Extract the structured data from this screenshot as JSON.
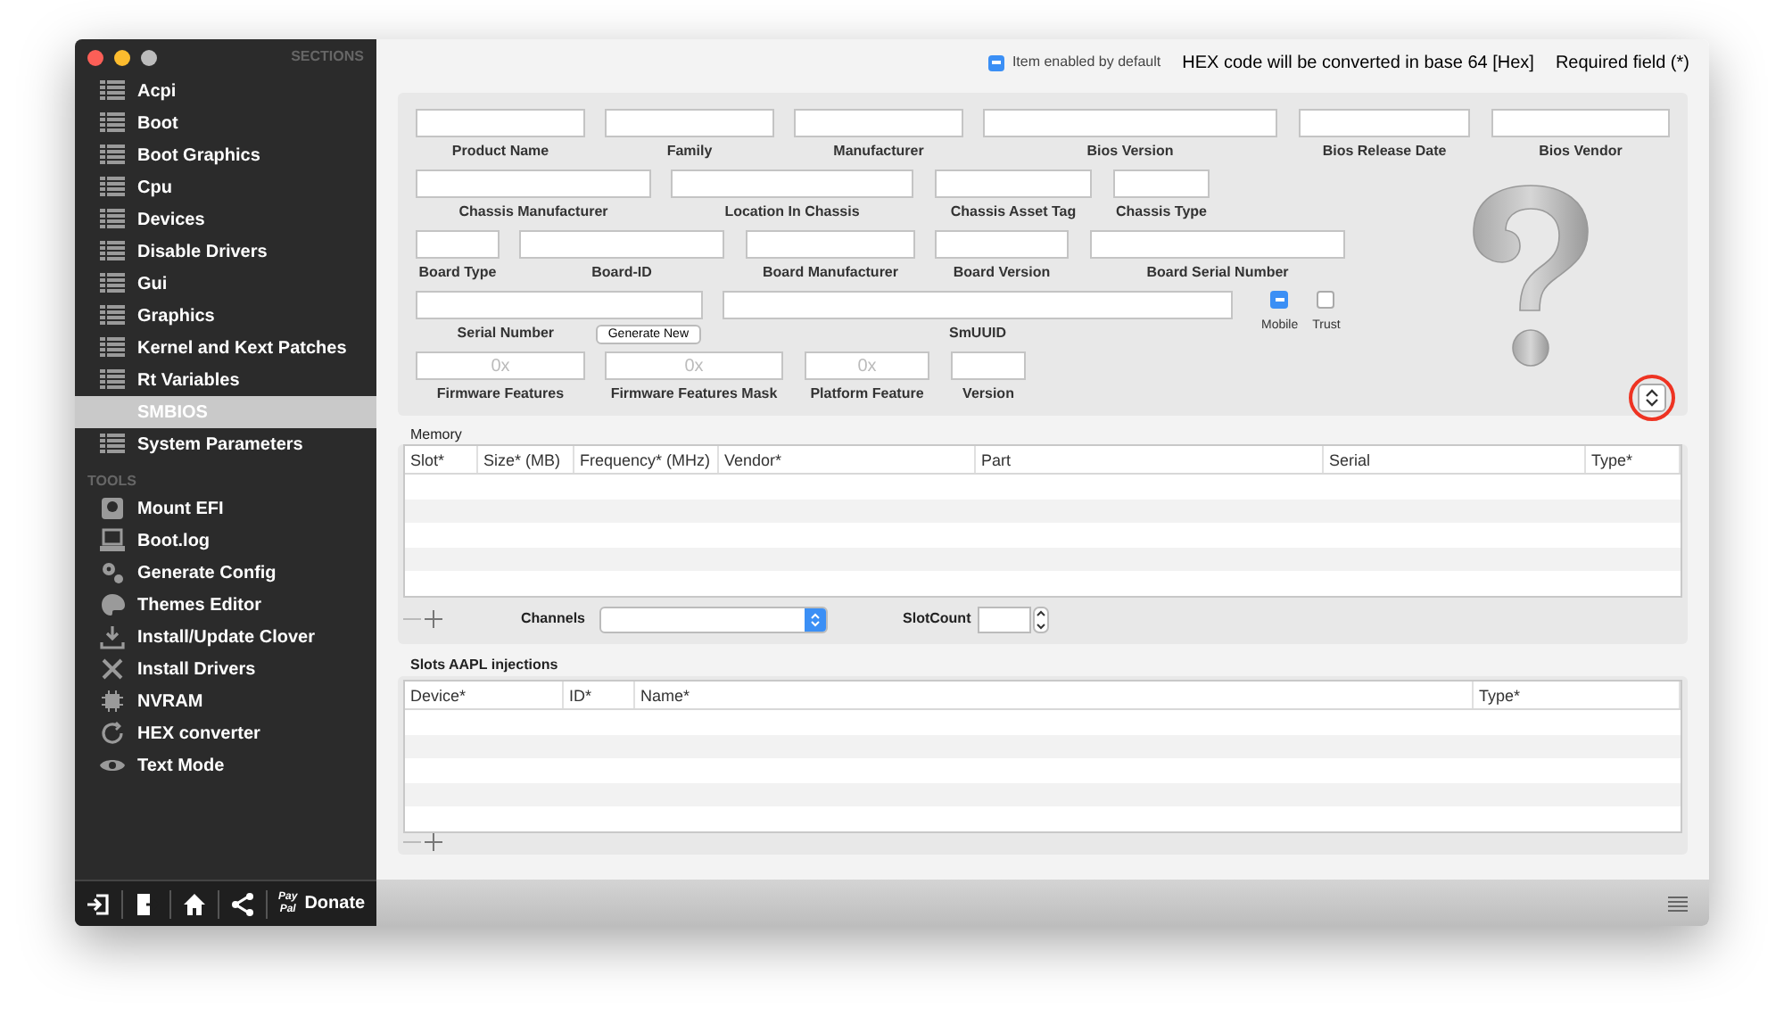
{
  "sidebar": {
    "sections_title": "SECTIONS",
    "sections": [
      {
        "label": "Acpi",
        "selected": false
      },
      {
        "label": "Boot",
        "selected": false
      },
      {
        "label": "Boot Graphics",
        "selected": false
      },
      {
        "label": "Cpu",
        "selected": false
      },
      {
        "label": "Devices",
        "selected": false
      },
      {
        "label": "Disable Drivers",
        "selected": false
      },
      {
        "label": "Gui",
        "selected": false
      },
      {
        "label": "Graphics",
        "selected": false
      },
      {
        "label": "Kernel and Kext Patches",
        "selected": false
      },
      {
        "label": "Rt Variables",
        "selected": false
      },
      {
        "label": "SMBIOS",
        "selected": true
      },
      {
        "label": "System Parameters",
        "selected": false
      }
    ],
    "tools_title": "TOOLS",
    "tools": [
      {
        "label": "Mount EFI",
        "kind": "disk"
      },
      {
        "label": "Boot.log",
        "kind": "log"
      },
      {
        "label": "Generate Config",
        "kind": "gears"
      },
      {
        "label": "Themes Editor",
        "kind": "palette"
      },
      {
        "label": "Install/Update Clover",
        "kind": "download"
      },
      {
        "label": "Install Drivers",
        "kind": "tools"
      },
      {
        "label": "NVRAM",
        "kind": "chip"
      },
      {
        "label": "HEX converter",
        "kind": "refresh"
      },
      {
        "label": "Text Mode",
        "kind": "eye"
      }
    ],
    "toolbar": {
      "paypal_top": "Pay",
      "paypal_bottom": "Pal",
      "donate": "Donate"
    }
  },
  "legend": {
    "enabled_label": "Item enabled by default",
    "hex_note": "HEX code will be converted in base 64 [Hex]",
    "required_note": "Required field (*)"
  },
  "smbios": {
    "product_fields": [
      {
        "label": "Product Name"
      },
      {
        "label": "Family"
      },
      {
        "label": "Manufacturer"
      },
      {
        "label": "Bios Version"
      },
      {
        "label": "Bios Release Date"
      },
      {
        "label": "Bios Vendor"
      }
    ],
    "chassis_fields": [
      {
        "label": "Chassis Manufacturer"
      },
      {
        "label": "Location In Chassis"
      },
      {
        "label": "Chassis  Asset Tag"
      },
      {
        "label": "Chassis Type"
      }
    ],
    "board_fields": [
      {
        "label": "Board Type"
      },
      {
        "label": "Board-ID"
      },
      {
        "label": "Board Manufacturer"
      },
      {
        "label": "Board Version"
      },
      {
        "label": "Board Serial Number"
      }
    ],
    "identity_fields": [
      {
        "label": "Serial Number"
      },
      {
        "label": "SmUUID"
      }
    ],
    "firmware_fields": [
      {
        "label": "Firmware Features",
        "placeholder": "0x"
      },
      {
        "label": "Firmware Features Mask",
        "placeholder": "0x"
      },
      {
        "label": "Platform Feature",
        "placeholder": "0x"
      },
      {
        "label": "Version"
      }
    ],
    "generate_button": "Generate New",
    "checkboxes": [
      {
        "label": "Mobile",
        "checked": true
      },
      {
        "label": "Trust",
        "checked": false
      }
    ]
  },
  "memory": {
    "title": "Memory",
    "columns": [
      "Slot*",
      "Size* (MB)",
      "Frequency* (MHz)",
      "Vendor*",
      "Part",
      "Serial",
      "Type*"
    ],
    "channels_label": "Channels",
    "slotcount_label": "SlotCount"
  },
  "slots": {
    "title": "Slots AAPL injections",
    "columns": [
      "Device*",
      "ID*",
      "Name*",
      "Type*"
    ]
  }
}
